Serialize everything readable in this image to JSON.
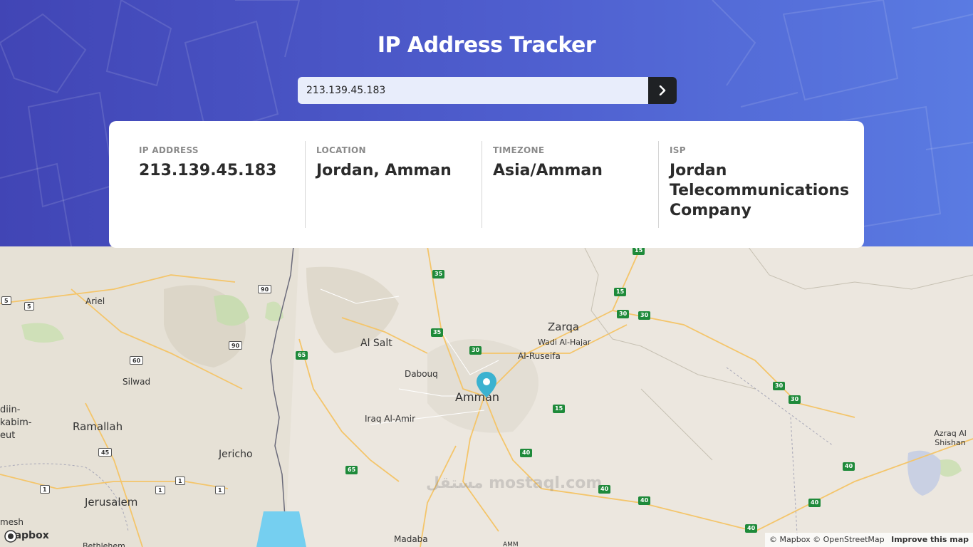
{
  "header": {
    "title": "IP Address Tracker",
    "search_value": "213.139.45.183",
    "colors": {
      "gradient_start": "#4145b5",
      "gradient_end": "#5a7be2",
      "button": "#1f2124"
    }
  },
  "info": [
    {
      "label": "IP ADDRESS",
      "value": "213.139.45.183"
    },
    {
      "label": "LOCATION",
      "value": "Jordan, Amman"
    },
    {
      "label": "TIMEZONE",
      "value": "Asia/Amman"
    },
    {
      "label": "ISP",
      "value": "Jordan Telecommunications Company"
    }
  ],
  "map": {
    "cities": {
      "ariel": "Ariel",
      "al_salt": "Al Salt",
      "zarqa": "Zarqa",
      "wadi_al_hajar": "Wadi Al-Hajar",
      "al_ruseifa": "Al-Ruseifa",
      "dabouq": "Dabouq",
      "amman": "Amman",
      "silwad": "Silwad",
      "iraq_al_amir": "Iraq Al-Amir",
      "ramallah": "Ramallah",
      "jericho": "Jericho",
      "jerusalem": "Jerusalem",
      "azraq": "Azraq Al Shishan",
      "madaba": "Madaba",
      "bethlehem": "Bethlehem",
      "diin": "diin-",
      "kabim": "kabim-",
      "eut": "eut",
      "mesh": "mesh",
      "amm": "AMM"
    },
    "road_numbers": {
      "r5a": "5",
      "r5b": "5",
      "r90a": "90",
      "r90b": "90",
      "r60": "60",
      "r45": "45",
      "r1a": "1",
      "r1b": "1",
      "r1c": "1",
      "r1d": "1",
      "r35a": "35",
      "r35b": "35",
      "r65a": "65",
      "r65b": "65",
      "r30a": "30",
      "r30b": "30",
      "r30c": "30",
      "r30d": "30",
      "r30e": "30",
      "r15a": "15",
      "r15b": "15",
      "r15c": "15",
      "r40a": "40",
      "r40b": "40",
      "r40c": "40",
      "r40d": "40",
      "r40e": "40",
      "r40f": "40"
    },
    "attribution": "© Mapbox © OpenStreetMap",
    "improve": "Improve this map",
    "logo": "mapbox",
    "watermark": "مستقل mostaql.com",
    "marker_icon": "location-pin-icon"
  }
}
